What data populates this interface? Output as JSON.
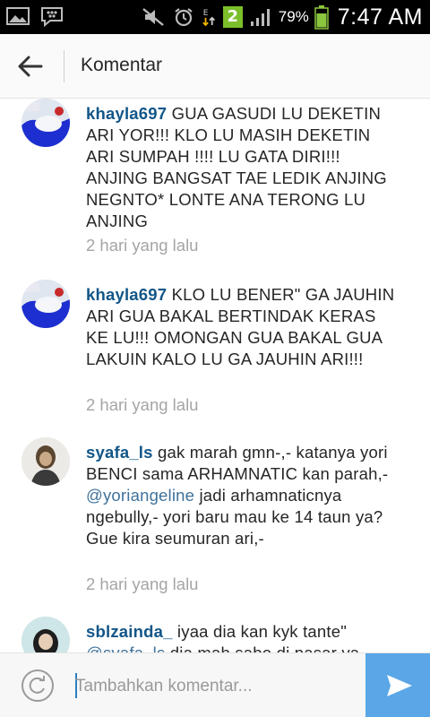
{
  "status_bar": {
    "battery_percent": "79%",
    "time": "7:47 AM",
    "notification_badge": "2",
    "icons": [
      "gallery-icon",
      "bbm-icon",
      "mute-icon",
      "alarm-icon",
      "data-transfer-icon",
      "signal-icon",
      "battery-icon"
    ]
  },
  "header": {
    "title": "Komentar"
  },
  "comments": [
    {
      "username": "khayla697",
      "text": " GUA GASUDI LU DEKETIN ARI YOR!!! KLO LU MASIH DEKETIN ARI SUMPAH !!!! LU GATA DIRI!!! ANJING BANGSAT TAE LEDIK ANJING NEGNTO* LONTE ANA TERONG LU ANJING",
      "time": "2 hari yang lalu"
    },
    {
      "username": "khayla697",
      "text": " KLO LU BENER\" GA JAUHIN ARI GUA BAKAL BERTINDAK KERAS KE LU!!! OMONGAN GUA BAKAL GUA LAKUIN KALO LU GA JAUHIN ARI!!!",
      "time": "2 hari yang lalu"
    },
    {
      "username": "syafa_ls",
      "text_before": " gak marah gmn-,- katanya yori BENCI sama ARHAMNATIC kan parah,- ",
      "mention": "@yoriangeline",
      "text_after": "  jadi arhamnaticnya ngebully,- yori baru mau ke 14 taun ya? Gue kira seumuran ari,-",
      "time": "2 hari yang lalu"
    },
    {
      "username": "sblzainda_",
      "text": " iyaa dia kan kyk tante\"",
      "mention": "@syafa_ls",
      "text_after": " dia mah sabo di pasar ya"
    }
  ],
  "composer": {
    "placeholder": "Tambahkan komentar..."
  },
  "colors": {
    "username": "#125688",
    "mention": "#3f729b",
    "timestamp": "#a5a5a5",
    "send_button": "#5aa6e6"
  }
}
